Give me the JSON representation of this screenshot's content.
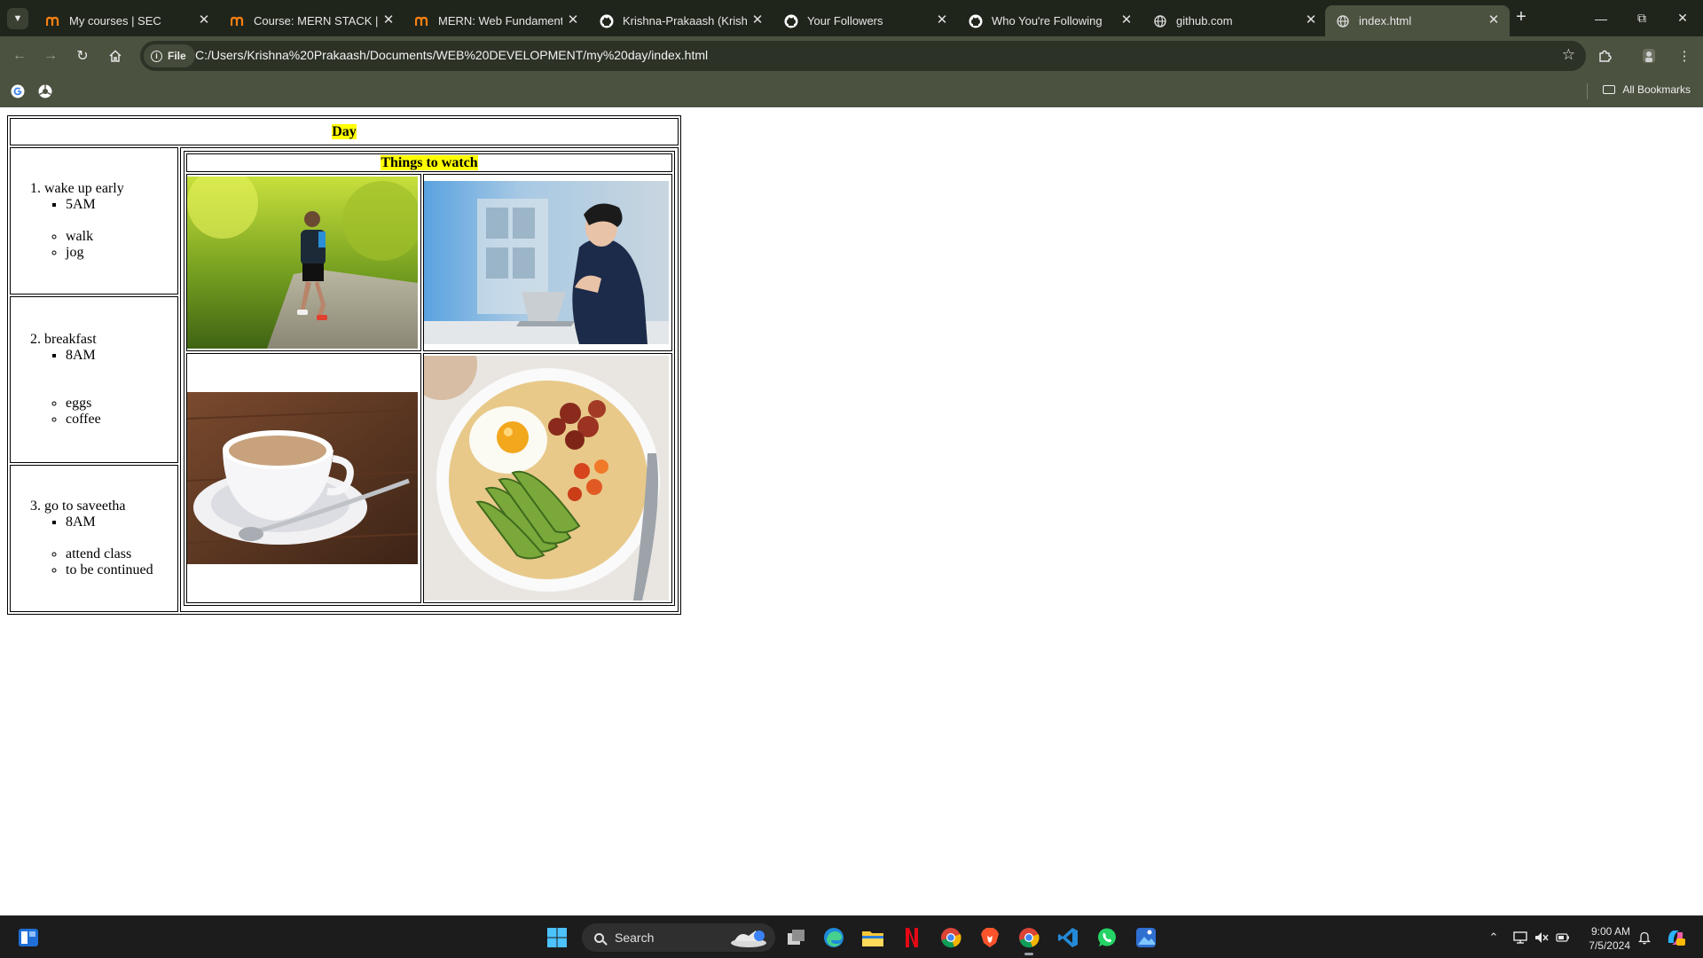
{
  "browser": {
    "tabs": [
      {
        "title": "My courses | SEC",
        "icon": "moodle-icon",
        "active": false
      },
      {
        "title": "Course: MERN STACK | SE",
        "icon": "moodle-icon",
        "active": false
      },
      {
        "title": "MERN: Web Fundamental",
        "icon": "moodle-icon",
        "active": false
      },
      {
        "title": "Krishna-Prakaash (Krishna",
        "icon": "github-icon",
        "active": false
      },
      {
        "title": "Your Followers",
        "icon": "github-icon",
        "active": false
      },
      {
        "title": "Who You're Following",
        "icon": "github-icon",
        "active": false
      },
      {
        "title": "github.com",
        "icon": "globe-icon",
        "active": false
      },
      {
        "title": "index.html",
        "icon": "globe-icon",
        "active": true
      }
    ],
    "omnibox": {
      "scheme_chip": "File",
      "url": "C:/Users/Krishna%20Prakaash/Documents/WEB%20DEVELOPMENT/my%20day/index.html"
    },
    "bookmarks": {
      "all_bookmarks_label": "All Bookmarks"
    },
    "colors": {
      "tabbar": "#20251c",
      "toolbar": "#4b5240",
      "active_tab": "#4b5240"
    }
  },
  "page": {
    "day_heading": "Day",
    "schedule": [
      {
        "number": "1.",
        "title": "wake up early",
        "time": "5AM",
        "activities": [
          "walk",
          "jog"
        ]
      },
      {
        "number": "2.",
        "title": "breakfast",
        "time": "8AM",
        "activities": [
          "eggs",
          "coffee"
        ]
      },
      {
        "number": "3.",
        "title": "go to saveetha",
        "time": "8AM",
        "activities": [
          "attend class",
          "to be continued"
        ]
      }
    ],
    "watch_heading": "Things to watch",
    "images": [
      {
        "name": "runner-photo"
      },
      {
        "name": "person-at-laptop-photo"
      },
      {
        "name": "coffee-cup-photo"
      },
      {
        "name": "breakfast-bowl-photo"
      }
    ],
    "highlight_color": "#ffff00"
  },
  "taskbar": {
    "search_label": "Search",
    "time": "9:00 AM",
    "date": "7/5/2024"
  }
}
